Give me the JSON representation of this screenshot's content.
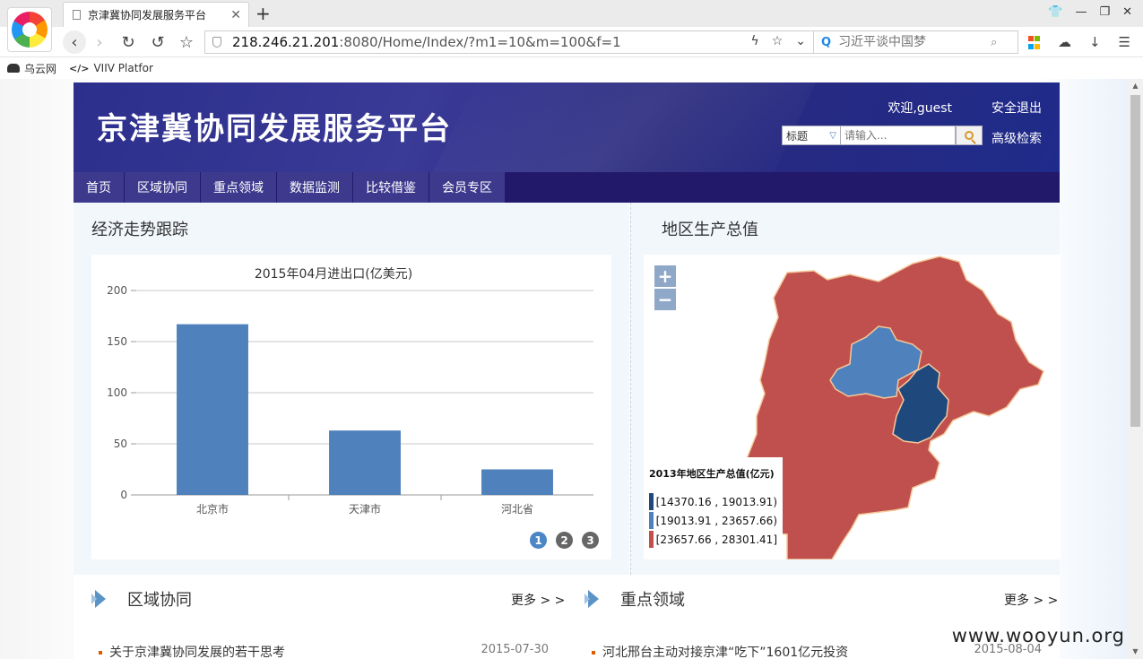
{
  "browser": {
    "tab_title": "京津冀协同发展服务平台",
    "url_host": "218.246.21.201",
    "url_rest": ":8080/Home/Index/?m1=10&m=100&f=1",
    "search_placeholder": "习近平谈中国梦",
    "bookmarks": [
      {
        "label": "乌云网"
      },
      {
        "label": "VIIV Platfor"
      }
    ],
    "bookmark_code_glyph": "</>"
  },
  "site": {
    "title": "京津冀协同发展服务平台",
    "welcome": "欢迎,guest",
    "logout": "安全退出",
    "search_select": "标题",
    "search_placeholder": "请输入...",
    "advanced_search": "高级检索",
    "nav": [
      "首页",
      "区域协同",
      "重点领域",
      "数据监测",
      "比较借鉴",
      "会员专区"
    ]
  },
  "economy": {
    "section_title": "经济走势跟踪",
    "pager": [
      "1",
      "2",
      "3"
    ]
  },
  "chart_data": {
    "type": "bar",
    "title": "2015年04月进出口(亿美元)",
    "categories": [
      "北京市",
      "天津市",
      "河北省"
    ],
    "values": [
      167,
      63,
      25
    ],
    "yticks": [
      "0",
      "50",
      "100",
      "150",
      "200"
    ],
    "ylim": [
      0,
      200
    ],
    "grid": true,
    "bar_color": "#4f81bd"
  },
  "gdp_map": {
    "section_title": "地区生产总值",
    "zoom_in": "+",
    "zoom_out": "−",
    "legend_title": "2013年地区生产总值(亿元)",
    "legend": [
      {
        "label": "[14370.16 , 19013.91)",
        "color": "#1f497d"
      },
      {
        "label": "[19013.91 , 23657.66)",
        "color": "#4f81bd"
      },
      {
        "label": "[23657.66 , 28301.41]",
        "color": "#c0504d"
      }
    ]
  },
  "lower": {
    "left": {
      "heading": "区域协同",
      "more": "更多 > >",
      "news_title": "关于京津冀协同发展的若干思考",
      "news_date": "2015-07-30"
    },
    "right": {
      "heading": "重点领域",
      "more": "更多 > >",
      "news_title": "河北邢台主动对接京津“吃下”1601亿元投资",
      "news_date": "2015-08-04"
    }
  },
  "watermark": "www.wooyun.org"
}
